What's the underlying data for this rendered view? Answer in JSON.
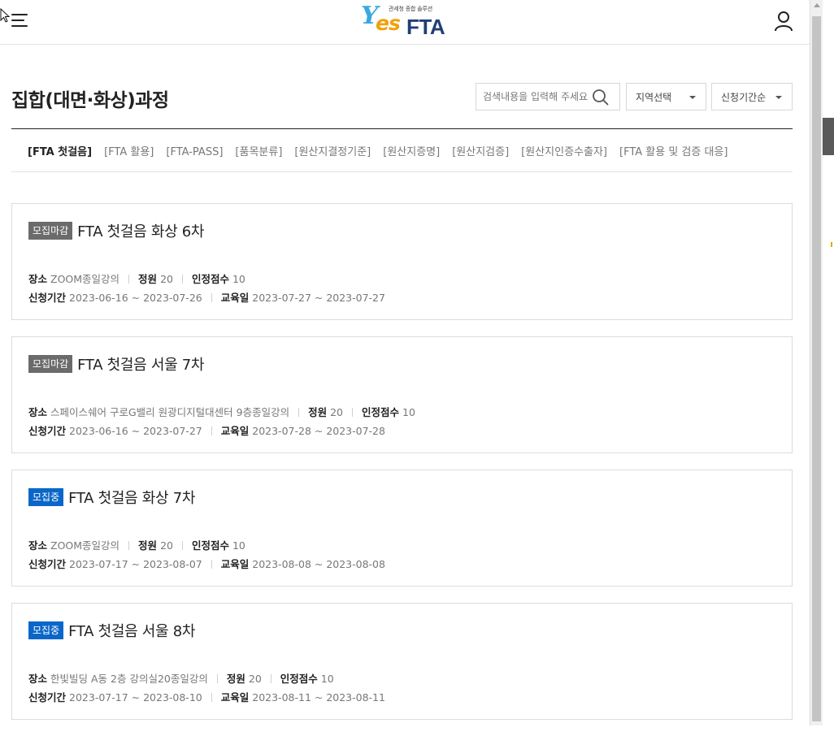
{
  "header": {
    "logo_sub": "관세청 종합 솔루션",
    "logo_y": "Y",
    "logo_es": "es",
    "logo_fta": "FTA"
  },
  "page": {
    "title": "집합(대면·화상)과정"
  },
  "search": {
    "placeholder": "검색내용을 입력해 주세요"
  },
  "filters": {
    "region": "지역선택",
    "sort": "신청기간순"
  },
  "tabs": [
    {
      "label": "[FTA 첫걸음]",
      "active": true
    },
    {
      "label": "[FTA 활용]",
      "active": false
    },
    {
      "label": "[FTA-PASS]",
      "active": false
    },
    {
      "label": "[품목분류]",
      "active": false
    },
    {
      "label": "[원산지결정기준]",
      "active": false
    },
    {
      "label": "[원산지증명]",
      "active": false
    },
    {
      "label": "[원산지검증]",
      "active": false
    },
    {
      "label": "[원산지인증수출자]",
      "active": false
    },
    {
      "label": "[FTA 활용 및 검증 대응]",
      "active": false
    }
  ],
  "labels": {
    "place": "장소",
    "capacity": "정원",
    "points": "인정점수",
    "apply_period": "신청기간",
    "edu_date": "교육일"
  },
  "courses": [
    {
      "status": "모집마감",
      "status_type": "closed",
      "title": "FTA 첫걸음 화상 6차",
      "place": "ZOOM종일강의",
      "capacity": "20",
      "points": "10",
      "apply_period": "2023-06-16 ~ 2023-07-26",
      "edu_date": "2023-07-27 ~ 2023-07-27"
    },
    {
      "status": "모집마감",
      "status_type": "closed",
      "title": "FTA 첫걸음 서울 7차",
      "place": "스페이스쉐어 구로G밸리 원광디지털대센터 9층종일강의",
      "capacity": "20",
      "points": "10",
      "apply_period": "2023-06-16 ~ 2023-07-27",
      "edu_date": "2023-07-28 ~ 2023-07-28"
    },
    {
      "status": "모집중",
      "status_type": "open",
      "title": "FTA 첫걸음 화상 7차",
      "place": "ZOOM종일강의",
      "capacity": "20",
      "points": "10",
      "apply_period": "2023-07-17 ~ 2023-08-07",
      "edu_date": "2023-08-08 ~ 2023-08-08"
    },
    {
      "status": "모집중",
      "status_type": "open",
      "title": "FTA 첫걸음 서울 8차",
      "place": "한빛빌딩 A동 2층 강의실20종일강의",
      "capacity": "20",
      "points": "10",
      "apply_period": "2023-07-17 ~ 2023-08-10",
      "edu_date": "2023-08-11 ~ 2023-08-11"
    }
  ],
  "colors": {
    "badge_closed": "#6b6b6b",
    "badge_open": "#0a66c8",
    "logo_blue": "#1f3f76",
    "logo_orange": "#f0a10c"
  },
  "icons": {
    "menu": "hamburger-menu-icon",
    "user": "user-icon",
    "search": "search-icon",
    "caret": "caret-down-icon"
  }
}
